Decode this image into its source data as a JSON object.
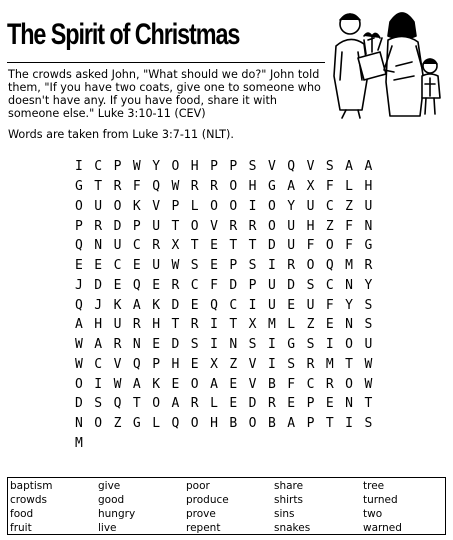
{
  "title": "The Spirit of Christmas",
  "intro": "The crowds asked John, \"What should we do?\"  John told them, \"If you have two coats, give one to someone who doesn't have any. If you have food, share it with someone else.\" Luke 3:10-11 (CEV)",
  "note": "Words are taken from Luke 3:7-11 (NLT).",
  "grid": [
    "ICPWYOHPPSVQVSA",
    "AGTRFQWRROHGAXF",
    "LHOUOKVPLOOIOYU",
    "CZUPRDPUTOVRROU",
    "HZFNQNUCRXTETTD",
    "UFOFGEECEUWSEPS",
    "IROQMRJDEQERCFD",
    "PUDSCNYQJKAKDEQ",
    "CIUEUFYSAHURHTR",
    "ITXMLZENSWARNED",
    "SINSIGSIOUWCVQP",
    "HEXZVISRMTWOIWA",
    "KEOAEVBFCROWDSQ",
    "TOARLEDREPENTNO",
    "ZGLQOHBOBAPTISM"
  ],
  "word_bank": [
    "baptism",
    "crowds",
    "food",
    "fruit",
    "give",
    "good",
    "hungry",
    "live",
    "poor",
    "produce",
    "prove",
    "repent",
    "share",
    "shirts",
    "sins",
    "snakes",
    "tree",
    "turned",
    "two",
    "warned"
  ]
}
